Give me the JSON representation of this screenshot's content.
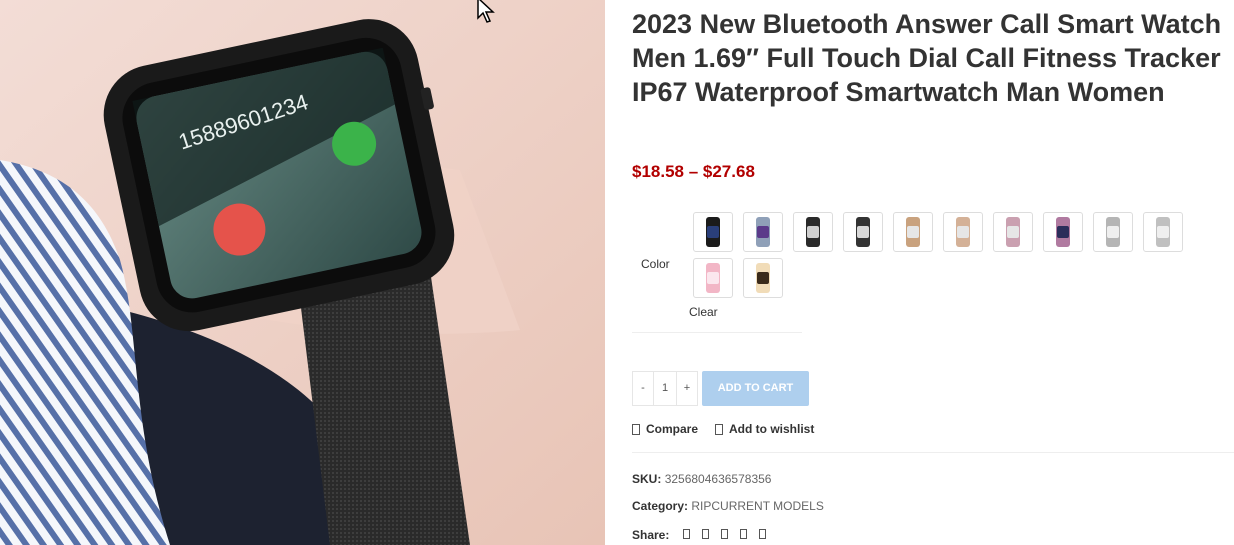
{
  "product": {
    "title": "2023 New Bluetooth Answer Call Smart Watch Men 1.69″ Full Touch Dial Call Fitness Tracker IP67 Waterproof Smartwatch Man Women",
    "price_range": "$18.58 – $27.68",
    "image_caption_number": "15889601234"
  },
  "variations": {
    "color_label": "Color",
    "clear_label": "Clear",
    "swatches": [
      {
        "name": "black",
        "color": "#1b1b1b"
      },
      {
        "name": "silver-blue",
        "color": "#8fa0b8"
      },
      {
        "name": "black-silver",
        "color": "#2a2a2a"
      },
      {
        "name": "black-mesh",
        "color": "#333333"
      },
      {
        "name": "gold-mesh",
        "color": "#c9a27e"
      },
      {
        "name": "rose-gold-mesh",
        "color": "#d4b197"
      },
      {
        "name": "pink-mesh",
        "color": "#caa0b0"
      },
      {
        "name": "pink-purple",
        "color": "#b07aa0"
      },
      {
        "name": "silver-mesh",
        "color": "#b5b5b5"
      },
      {
        "name": "silver-mesh-2",
        "color": "#c0c0c0"
      },
      {
        "name": "pink",
        "color": "#f2b6c6"
      },
      {
        "name": "cream-gold",
        "color": "#f1dcb8"
      }
    ]
  },
  "cart": {
    "qty_minus": "-",
    "qty_value": "1",
    "qty_plus": "+",
    "add_to_cart": "ADD TO CART"
  },
  "actions": {
    "compare": "Compare",
    "wishlist": "Add to wishlist"
  },
  "meta": {
    "sku_label": "SKU:",
    "sku_value": "3256804636578356",
    "category_label": "Category:",
    "category_value": "RIPCURRENT MODELS",
    "share_label": "Share:"
  },
  "colors": {
    "price": "#b20000",
    "add_to_cart_bg": "#aecfee"
  }
}
